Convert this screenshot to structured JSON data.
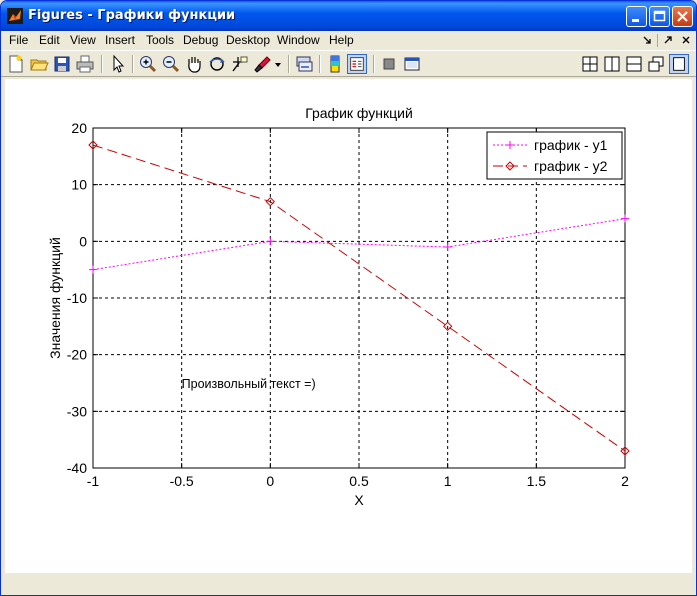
{
  "window": {
    "title": "Figures - Графики функции"
  },
  "menu": [
    "File",
    "Edit",
    "View",
    "Insert",
    "Tools",
    "Debug",
    "Desktop",
    "Window",
    "Help"
  ],
  "colors": {
    "titlebar": "#0058ee",
    "series1": "#ff00ff",
    "series2": "#cc0000",
    "grid": "#000000"
  },
  "icons": {
    "title_buttons": [
      "minimize-icon",
      "maximize-icon",
      "close-icon"
    ],
    "toolbar_left": [
      "new-figure-icon",
      "open-file-icon",
      "save-icon",
      "print-icon",
      "pointer-icon",
      "zoom-in-icon",
      "zoom-out-icon",
      "pan-hand-icon",
      "rotate-3d-icon",
      "data-cursor-icon",
      "brush-icon",
      "brush-dropdown-icon",
      "link-plot-icon",
      "colorbar-icon",
      "legend-icon",
      "hide-plot-tools-icon",
      "show-plot-tools-icon"
    ],
    "toolbar_right": [
      "tile-grid-icon",
      "tile-columns-icon",
      "tile-rows-icon",
      "float-windows-icon",
      "maximize-figure-icon"
    ]
  },
  "chart_data": {
    "type": "line",
    "title": "График функций",
    "xlabel": "X",
    "ylabel": "Значения функций",
    "xlim": [
      -1,
      2
    ],
    "ylim": [
      -40,
      20
    ],
    "xticks": [
      -1,
      -0.5,
      0,
      0.5,
      1,
      1.5,
      2
    ],
    "yticks": [
      -40,
      -30,
      -20,
      -10,
      0,
      10,
      20
    ],
    "xtick_labels": [
      "-1",
      "-0.5",
      "0",
      "0.5",
      "1",
      "1.5",
      "2"
    ],
    "ytick_labels": [
      "-40",
      "-30",
      "-20",
      "-10",
      "0",
      "10",
      "20"
    ],
    "grid": true,
    "legend_position": "top-right",
    "annotation": {
      "text": "Произвольный текст =)",
      "x": -0.5,
      "y": -25
    },
    "series": [
      {
        "name": "график - y1",
        "marker": "+",
        "linestyle": "dotted",
        "color": "#ff00ff",
        "x": [
          -1,
          0,
          1,
          2
        ],
        "y": [
          -5,
          0,
          -1,
          4
        ]
      },
      {
        "name": "график - y2",
        "marker": "diamond",
        "linestyle": "dashed",
        "color": "#cc0000",
        "x": [
          -1,
          0,
          1,
          2
        ],
        "y": [
          17,
          7,
          -15,
          -37
        ]
      }
    ]
  }
}
